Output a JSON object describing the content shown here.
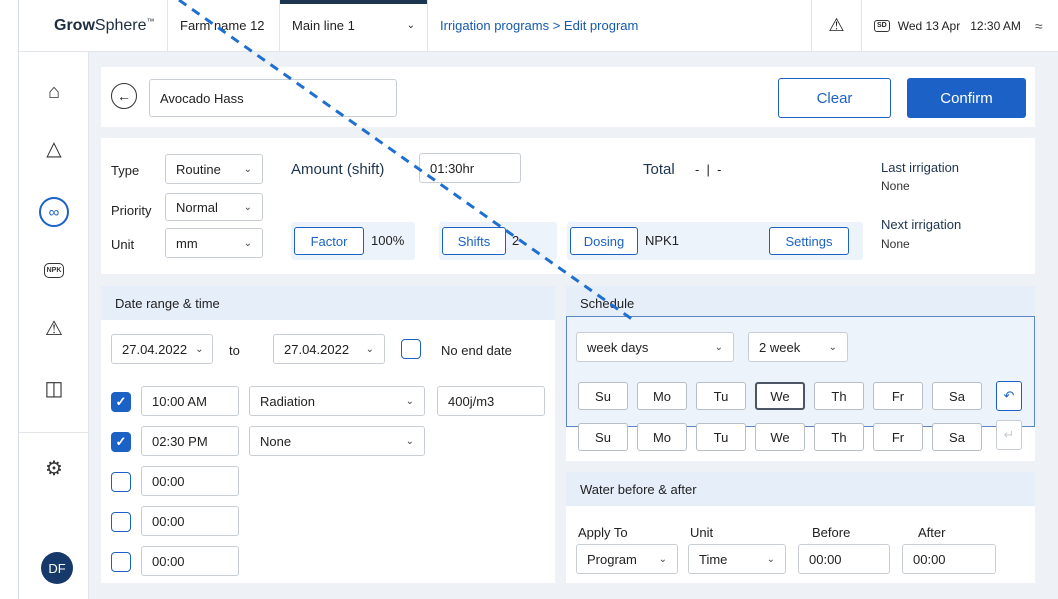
{
  "app": {
    "brand_bold": "Grow",
    "brand_light": "Sphere",
    "brand_tm": "™"
  },
  "topbar": {
    "farm": "Farm name 12",
    "line": "Main line 1",
    "breadcrumb": "Irrigation programs > Edit program",
    "warning_icon": "warning-icon",
    "sd_label": "SD",
    "datetime": "Wed 13 Apr   12:30 AM",
    "wifi_icon": "wifi-icon"
  },
  "sidebar": {
    "items": [
      "home-icon",
      "sites-icon",
      "irrigation-icon",
      "npk-icon",
      "alerts-icon",
      "layout-icon",
      "settings-icon"
    ],
    "npk_label": "NPK",
    "avatar": "DF",
    "active": "irrigation-icon"
  },
  "program": {
    "name": "Avocado Hass",
    "clear_label": "Clear",
    "confirm_label": "Confirm"
  },
  "config": {
    "type_label": "Type",
    "type_value": "Routine",
    "priority_label": "Priority",
    "priority_value": "Normal",
    "unit_label": "Unit",
    "unit_value": "mm",
    "amount_label": "Amount (shift)",
    "amount_value": "01:30hr",
    "total_label": "Total",
    "total_value": "-  |  -",
    "factor_label": "Factor",
    "factor_value": "100%",
    "shifts_label": "Shifts",
    "shifts_value": "2",
    "dosing_label": "Dosing",
    "dosing_value": "NPK1",
    "settings_label": "Settings",
    "last_irrigation_label": "Last irrigation",
    "last_irrigation_value": "None",
    "next_irrigation_label": "Next irrigation",
    "next_irrigation_value": "None"
  },
  "date_range": {
    "title": "Date range & time",
    "start": "27.04.2022",
    "to_label": "to",
    "end": "27.04.2022",
    "no_end_label": "No end date",
    "rows": [
      {
        "checked": true,
        "time": "10:00 AM",
        "condition": "Radiation",
        "value": "400j/m3"
      },
      {
        "checked": true,
        "time": "02:30 PM",
        "condition": "None"
      },
      {
        "checked": false,
        "time": "00:00"
      },
      {
        "checked": false,
        "time": "00:00"
      },
      {
        "checked": false,
        "time": "00:00"
      }
    ]
  },
  "schedule": {
    "title": "Schedule",
    "mode": "week days",
    "period": "2 week",
    "week1": [
      "Su",
      "Mo",
      "Tu",
      "We",
      "Th",
      "Fr",
      "Sa"
    ],
    "week2": [
      "Su",
      "Mo",
      "Tu",
      "We",
      "Th",
      "Fr",
      "Sa"
    ],
    "selected_week1": "We"
  },
  "water": {
    "title": "Water before & after",
    "apply_to_label": "Apply To",
    "apply_to_value": "Program",
    "unit_label": "Unit",
    "unit_value": "Time",
    "before_label": "Before",
    "before_value": "00:00",
    "after_label": "After",
    "after_value": "00:00"
  }
}
